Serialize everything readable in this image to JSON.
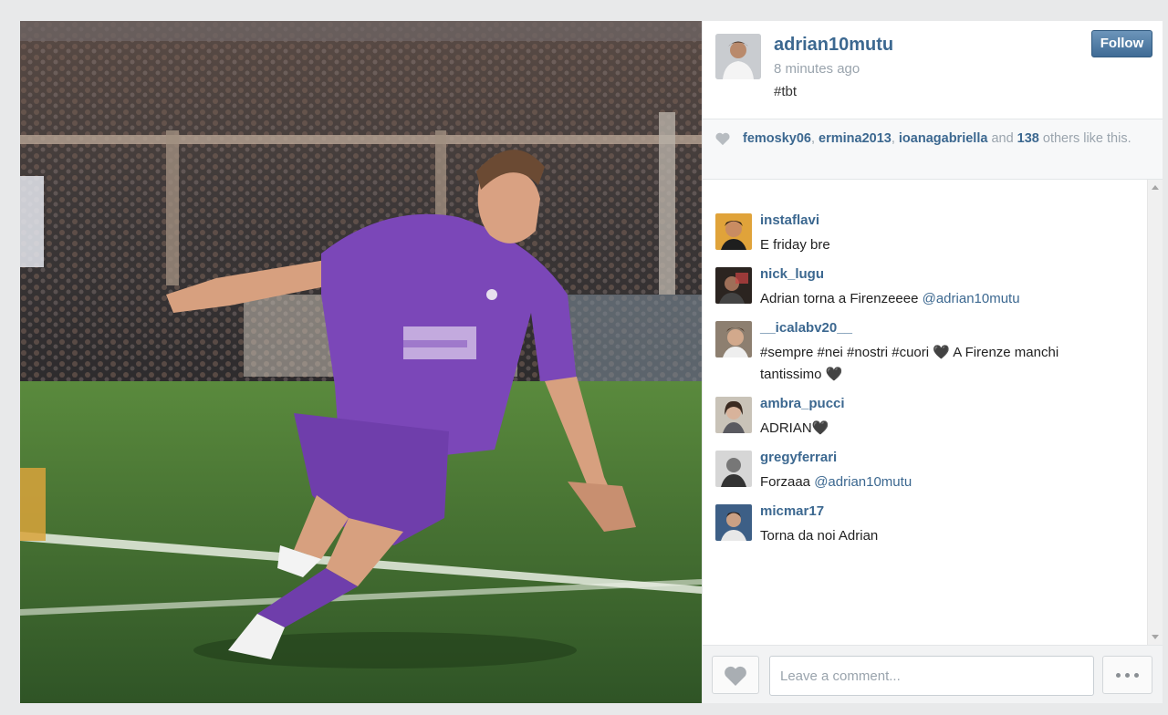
{
  "post": {
    "username": "adrian10mutu",
    "timestamp": "8 minutes ago",
    "caption": "#tbt",
    "follow_label": "Follow"
  },
  "likes": {
    "likers": [
      "femosky06",
      "ermina2013",
      "ioanagabriella"
    ],
    "sep1": ", ",
    "sep2": ", ",
    "and_text": " and ",
    "others_count": "138",
    "others_text": " others like this."
  },
  "comments": [
    {
      "username": "instaflavi",
      "text": "E friday bre"
    },
    {
      "username": "nick_lugu",
      "text": "Adrian torna a Firenzeeee ",
      "mention": "@adrian10mutu"
    },
    {
      "username": "__icalabv20__",
      "text": "#sempre #nei #nostri #cuori 🖤 A Firenze manchi tantissimo 🖤"
    },
    {
      "username": "ambra_pucci",
      "text": "ADRIAN🖤"
    },
    {
      "username": "gregyferrari",
      "text": "Forzaaa ",
      "mention": "@adrian10mutu"
    },
    {
      "username": "micmar17",
      "text": "Torna da noi Adrian"
    }
  ],
  "footer": {
    "comment_placeholder": "Leave a comment..."
  },
  "icons": {
    "like": "heart-icon",
    "more": "ellipsis-icon"
  },
  "colors": {
    "link": "#3c6890",
    "follow_button": "#4a76a0",
    "jersey": "#7b47b8",
    "pitch": "#3f6a33"
  }
}
